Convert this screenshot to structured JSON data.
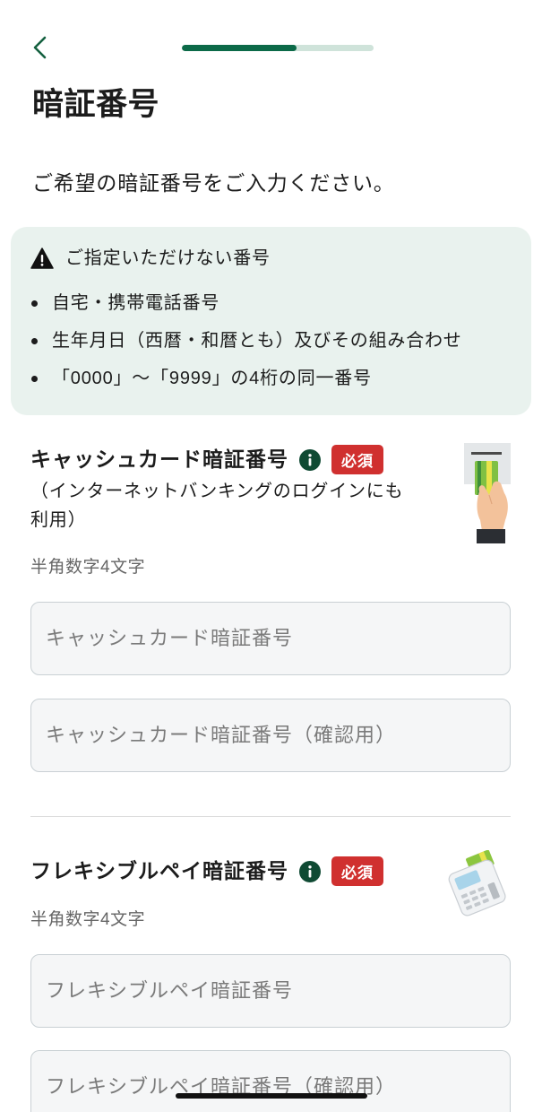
{
  "colors": {
    "accent": "#0c6a48",
    "progress_track": "#cfe3da",
    "notice_background": "#e9f2ee",
    "required_badge": "#d0302f",
    "info_icon": "#0f4a33",
    "input_background": "#f5f6f7",
    "input_border": "#c9d0d4"
  },
  "header": {
    "back_icon": "chevron-left-icon",
    "progress": 0.6
  },
  "page": {
    "title": "暗証番号",
    "subtitle": "ご希望の暗証番号をご入力ください。"
  },
  "notice": {
    "icon": "warning-icon",
    "heading": "ご指定いただけない番号",
    "items": [
      "自宅・携帯電話番号",
      "生年月日（西暦・和暦とも）及びその組み合わせ",
      "「0000」〜「9999」の4桁の同一番号"
    ]
  },
  "sections": [
    {
      "label": "キャッシュカード暗証番号",
      "info_icon": "info-icon",
      "required_label": "必須",
      "note": "（インターネットバンキングのログインにも利用）",
      "illustration": "hand-holding-card-illustration",
      "hint": "半角数字4文字",
      "fields": [
        {
          "value": "",
          "placeholder": "キャッシュカード暗証番号"
        },
        {
          "value": "",
          "placeholder": "キャッシュカード暗証番号（確認用）"
        }
      ]
    },
    {
      "label": "フレキシブルペイ暗証番号",
      "info_icon": "info-icon",
      "required_label": "必須",
      "illustration": "card-terminal-illustration",
      "hint": "半角数字4文字",
      "fields": [
        {
          "value": "",
          "placeholder": "フレキシブルペイ暗証番号"
        },
        {
          "value": "",
          "placeholder": "フレキシブルペイ暗証番号（確認用）"
        }
      ]
    }
  ]
}
